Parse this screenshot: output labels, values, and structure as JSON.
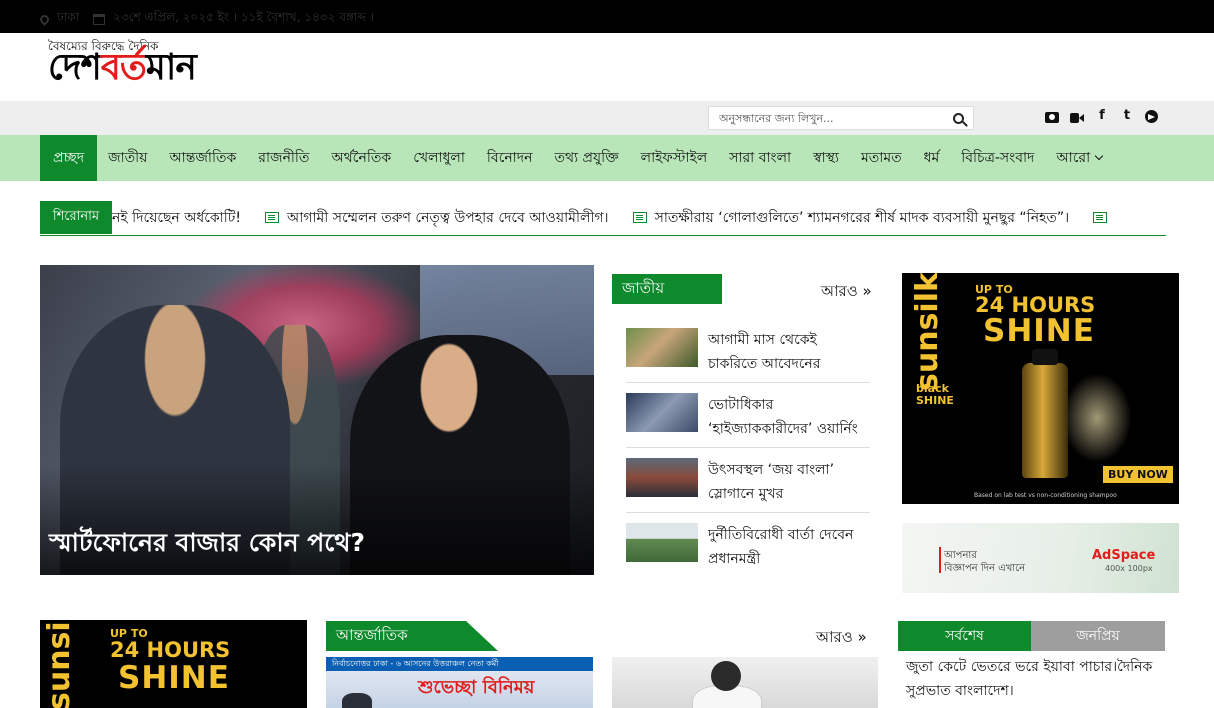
{
  "site": {
    "tagline": "বৈষম্যের বিরুদ্ধে দৈনিক",
    "logo_part1": "দেশ",
    "logo_part2": "বর্ত",
    "logo_part3": "মান"
  },
  "infobar": {
    "location": "ঢাকা",
    "date": "২৩শে এপ্রিল, ২০২৫ ইং । ১১ই বৈশাখ, ১৪৩২ বঙ্গাব্দ ।",
    "search_placeholder": "অনুসন্ধানের জন্য লিখুন...",
    "social_icons": [
      "camera-icon",
      "video-icon",
      "facebook-icon",
      "twitter-icon",
      "telegram-icon"
    ],
    "facebook_glyph": "f",
    "twitter_glyph": "t"
  },
  "nav": {
    "items": [
      "প্রচ্ছদ",
      "জাতীয়",
      "আন্তর্জাতিক",
      "রাজনীতি",
      "অর্থনৈতিক",
      "খেলাধুলা",
      "বিনোদন",
      "তথ্য প্রযুক্তি",
      "লাইফস্টাইল",
      "সারা বাংলা",
      "স্বাস্থ্য",
      "মতামত",
      "ধর্ম",
      "বিচিত্র-সংবাদ",
      "আরো"
    ]
  },
  "ticker": {
    "label": "শিরোনাম",
    "items": [
      "নই দিয়েছেন অর্ধকোটি!",
      "আগামী সম্মেলন তরুণ নেতৃত্ব উপহার দেবে আওয়ামীলীগ।",
      "সাতক্ষীরায় ‘গোলাগুলিতে’ শ্যামনগরের শীর্ষ মাদক ব্যবসায়ী মুনছুর “নিহত”।"
    ]
  },
  "hero": {
    "title": "স্মার্টফোনের বাজার কোন পথে?"
  },
  "national": {
    "label": "জাতীয়",
    "more": "আরও »",
    "items": [
      {
        "line1": "আগামী মাস থেকেই",
        "line2": "চাকরিতে আবেদনের"
      },
      {
        "line1": "ভোটাধিকার",
        "line2": "‘হাইজ্যাককারীদের’ ওয়ার্নিং"
      },
      {
        "line1": "উৎসবস্থল ‘জয় বাংলা’",
        "line2": "স্লোগানে মুখর"
      },
      {
        "line1": "দুর্নীতিবিরোধী বার্তা দেবেন",
        "line2": "প্রধানমন্ত্রী"
      }
    ]
  },
  "ad_main": {
    "brand": "sunsilk",
    "sub": "black SHINE",
    "up_to": "UP TO",
    "hours": "24 HOURS",
    "shine": "SHINE",
    "buy": "BUY NOW",
    "fine": "Based on lab test vs non-conditioning shampoo"
  },
  "ad_space": {
    "line1": "আপনার",
    "line2": "বিজ্ঞাপন দিন এখানে",
    "brand": "AdSpace",
    "size": "400x 100px"
  },
  "international": {
    "label": "আন্তর্জাতিক",
    "more": "আরও »",
    "img_banner": "নির্বাচনোত্তর ঢাকা - ৬ আসনের উত্তরাঞ্চল নেতা কর্মী",
    "img_big": "শুভেচ্ছা বিনিময়"
  },
  "side_tabs": {
    "tab_latest": "সর্বশেষ",
    "tab_popular": "জনপ্রিয়",
    "latest_item": "জুতা কেটে ভেতরে ভরে ইয়াবা পাচার।দৈনিক সুপ্রভাত বাংলাদেশ।"
  },
  "colors": {
    "brand_green": "#0e8a2c",
    "nav_bg": "#b8e6b8",
    "logo_red": "#e21b1b",
    "ad_gold": "#f2c230"
  }
}
